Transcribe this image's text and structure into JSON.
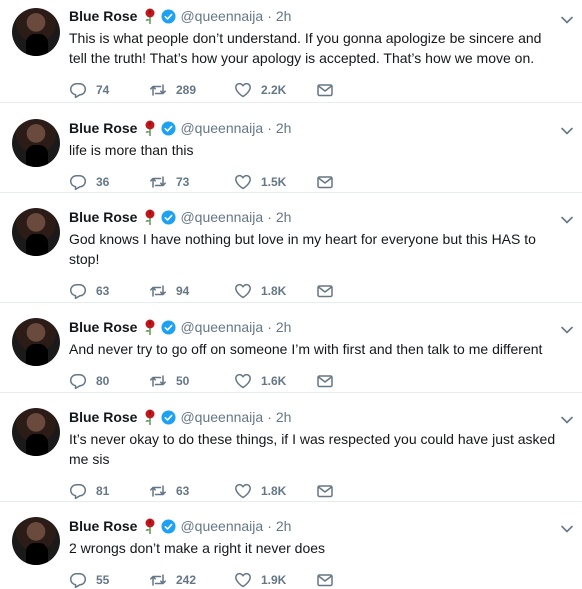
{
  "tweets": [
    {
      "name": "Blue Rose",
      "handle": "@queennaija",
      "time": "2h",
      "text": "This is what people don’t understand. If you gonna apologize be sincere and tell the truth! That’s how your apology is accepted. That’s how we move on.",
      "replies": "74",
      "retweets": "289",
      "likes": "2.2K"
    },
    {
      "name": "Blue Rose",
      "handle": "@queennaija",
      "time": "2h",
      "text": "life is more than this",
      "replies": "36",
      "retweets": "73",
      "likes": "1.5K"
    },
    {
      "name": "Blue Rose",
      "handle": "@queennaija",
      "time": "2h",
      "text": "God knows I have nothing but love in my heart for everyone but this HAS to stop!",
      "replies": "63",
      "retweets": "94",
      "likes": "1.8K"
    },
    {
      "name": "Blue Rose",
      "handle": "@queennaija",
      "time": "2h",
      "text": "And never try to go off on someone I’m with first and then talk to me different",
      "replies": "80",
      "retweets": "50",
      "likes": "1.6K"
    },
    {
      "name": "Blue Rose",
      "handle": "@queennaija",
      "time": "2h",
      "text": "It’s never okay to do these things, if I was respected you could have just asked me sis",
      "replies": "81",
      "retweets": "63",
      "likes": "1.8K"
    },
    {
      "name": "Blue Rose",
      "handle": "@queennaija",
      "time": "2h",
      "text": "2 wrongs don’t make a right it never does",
      "replies": "55",
      "retweets": "242",
      "likes": "1.9K"
    }
  ],
  "separator": "·",
  "colors": {
    "text": "#14171a",
    "muted": "#657786",
    "verified": "#1da1f2",
    "divider": "#e6ecf0",
    "rose": "#c0171d"
  },
  "icons": {
    "reply": "reply-icon",
    "retweet": "retweet-icon",
    "like": "heart-icon",
    "message": "envelope-icon",
    "caret": "chevron-down-icon",
    "verified": "verified-badge-icon",
    "emoji": "rose-emoji"
  }
}
